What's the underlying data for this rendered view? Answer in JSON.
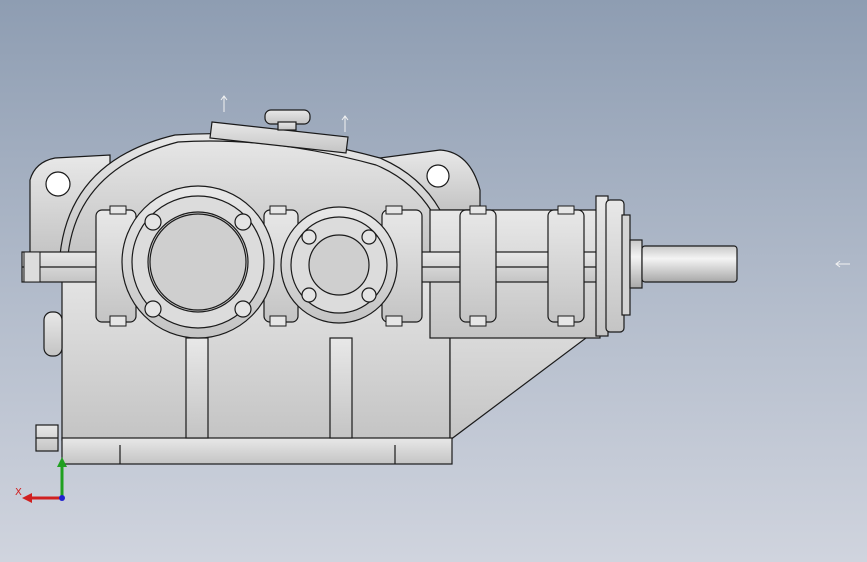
{
  "viewport": {
    "background_top": "#8e9db2",
    "background_bottom": "#d0d4de"
  },
  "model": {
    "description_icon": "gear-reducer-assembly",
    "shade_color": "#d8d8d8",
    "edge_color": "#1a1a1a"
  },
  "triad": {
    "x_label": "X",
    "x_color": "#d02020",
    "y_color": "#20a020",
    "z_color": "#2020d0"
  }
}
